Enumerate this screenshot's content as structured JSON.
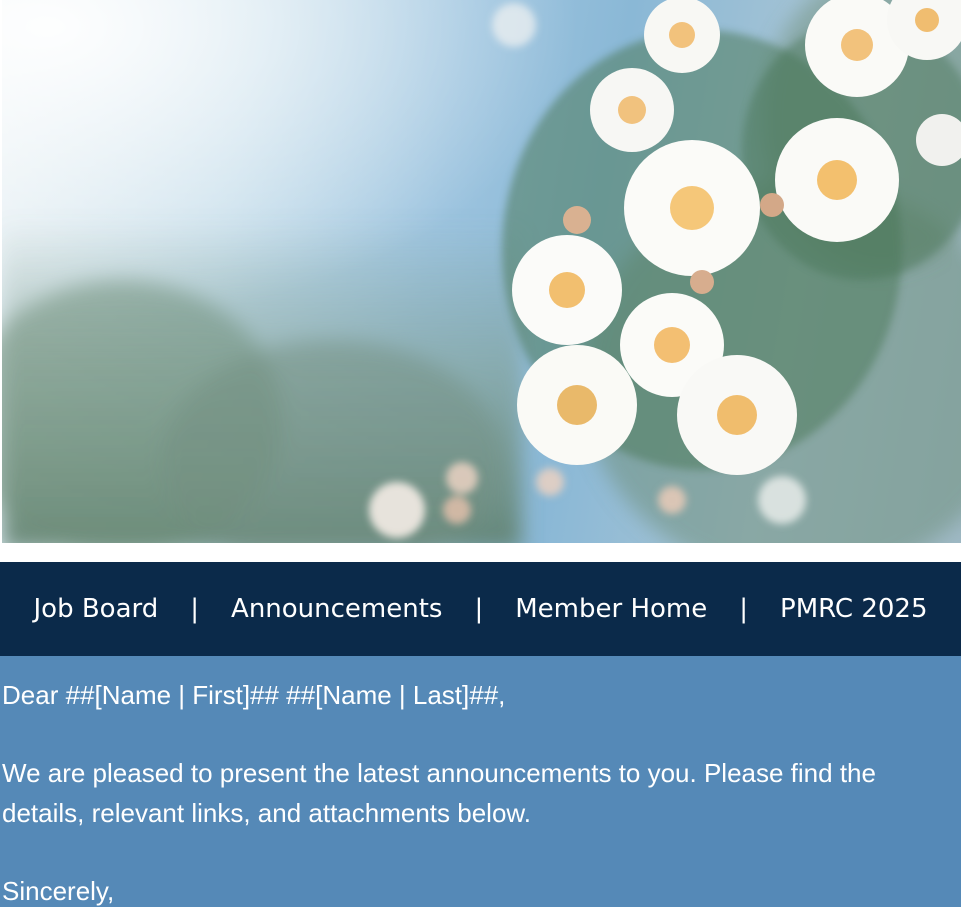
{
  "hero": {
    "image_desc": "banner-photo"
  },
  "nav": {
    "items": [
      {
        "label": "Job Board"
      },
      {
        "label": "Announcements"
      },
      {
        "label": "Member Home"
      },
      {
        "label": "PMRC 2025"
      }
    ],
    "separator": "|"
  },
  "content": {
    "greeting": "Dear ##[Name | First]## ##[Name | Last]##,",
    "body": "We are pleased to present the latest announcements to you. Please find the details, relevant links, and attachments below.",
    "closing": "Sincerely,"
  },
  "colors": {
    "nav_bg": "#0b2a4a",
    "content_bg": "#5589b7"
  }
}
